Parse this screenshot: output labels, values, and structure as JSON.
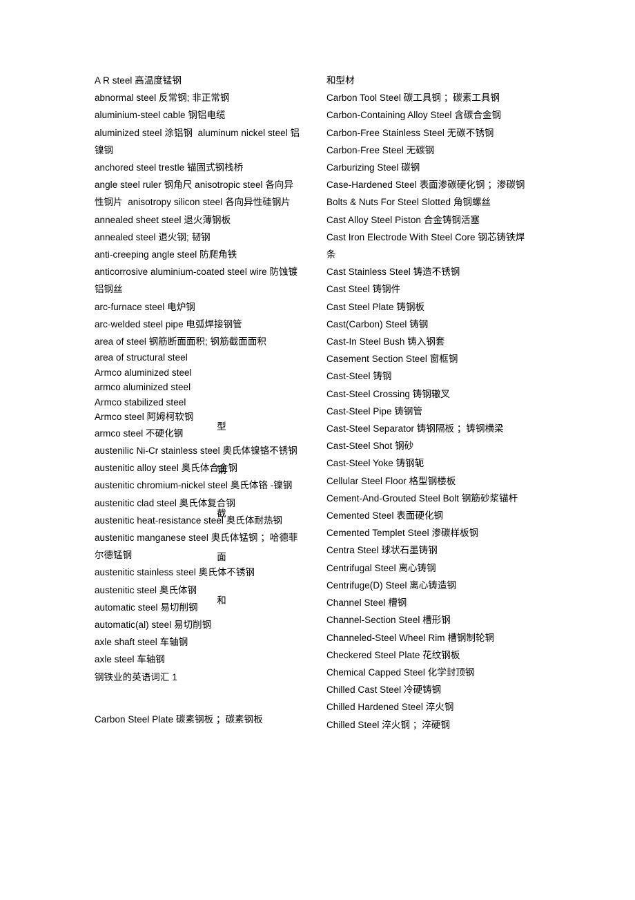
{
  "document": {
    "page_background": "#ffffff",
    "text_color": "#000000",
    "footer_note": "钢铁业的英语词汇 1"
  },
  "left_column": {
    "entries": [
      "A R steel 高温度锰钢",
      "abnormal steel 反常钢; 非正常钢",
      "aluminium-steel cable 钢铝电缆",
      "aluminized steel 涂铝钢  aluminum nickel steel 铝镍钢",
      "anchored steel trestle 锚固式钢栈桥",
      "angle steel ruler 钢角尺 anisotropic steel 各向异性钢片  anisotropy silicon steel 各向异性硅钢片  annealed sheet steel 退火薄钢板",
      "annealed steel 退火钢; 韧钢",
      "anti-creeping angle steel 防爬角铁",
      "anticorrosive aluminium-coated steel wire 防蚀镀铝钢丝",
      "arc-furnace steel 电炉钢",
      "arc-welded steel pipe 电弧焊接钢管",
      "area of steel 钢筋断面面积; 钢筋截面面积",
      "area of structural steel",
      "Armco aluminized steel",
      "armco aluminized steel",
      "Armco stabilized steel",
      "Armco steel 阿姆柯软钢",
      "armco steel 不硬化钢",
      "austenilic Ni-Cr stainless steel 奥氏体镍铬不锈钢",
      "austenitic alloy steel 奥氏体合金钢",
      "austenitic chromium-nickel steel 奥氏体铬 -镍钢",
      "austenitic clad steel 奥氏体复合钢",
      "austenitic heat-resistance steel 奥氏体耐热钢",
      "austenitic manganese steel 奥氏体锰钢 ；哈德菲尔德锰钢",
      "austenitic stainless steel 奥氏体不锈钢",
      "austenitic steel 奥氏体钢",
      "automatic steel 易切削钢",
      "automatic(al) steel 易切削钢",
      "axle shaft steel 车轴钢",
      "axle steel 车轴钢",
      "钢铁业的英语词汇 1",
      "Carbon Steel Plate 碳素钢板 ；碳素钢板"
    ],
    "vertical_text": {
      "characters": [
        "型",
        "钢",
        "截",
        "面",
        "和"
      ],
      "full": "型钢截面和"
    }
  },
  "right_column": {
    "entries": [
      "和型材",
      "Carbon Tool Steel 碳工具钢 ；碳素工具钢",
      "Carbon-Containing Alloy Steel 含碳合金钢",
      "Carbon-Free Stainless Steel 无碳不锈钢",
      "Carbon-Free Steel 无碳钢",
      "Carburizing Steel 碳钢",
      "Case-Hardened Steel 表面渗碳硬化钢 ；渗碳钢",
      "Bolts & Nuts For Steel Slotted 角钢螺丝",
      "Cast Alloy Steel Piston 合金铸钢活塞",
      "Cast Iron Electrode With Steel Core 钢芯铸铁焊条",
      "Cast Stainless Steel 铸造不锈钢",
      "Cast Steel 铸钢件",
      "Cast Steel Plate 铸钢板",
      "Cast(Carbon) Steel 铸钢",
      "Cast-In Steel Bush 铸入钢套",
      "Casement Section Steel 窗框钢",
      "Cast-Steel 铸钢",
      "Cast-Steel Crossing 铸钢辙叉",
      "Cast-Steel Pipe 铸钢管",
      "Cast-Steel Separator 铸钢隔板 ；铸钢横梁",
      "Cast-Steel Shot 钢砂",
      "Cast-Steel Yoke 铸钢轭",
      "Cellular Steel Floor 格型钢楼板",
      "Cement-And-Grouted Steel Bolt 钢筋砂浆锚杆",
      "Cemented Steel 表面硬化钢",
      "Cemented Templet Steel 渗碳样板钢",
      "Centra Steel 球状石墨铸钢",
      "Centrifugal Steel 离心铸钢",
      "Centrifuge(D) Steel 离心铸造钢",
      "Channel Steel 槽钢",
      "Channel-Section Steel 槽形钢",
      "Channeled-Steel Wheel Rim 槽钢制轮辋",
      "Checkered Steel Plate 花纹钢板",
      "Chemical Capped Steel 化学封顶钢",
      "Chilled Cast Steel 冷硬铸钢",
      "Chilled Hardened Steel 淬火钢",
      "Chilled Steel 淬火钢 ；淬硬钢"
    ]
  }
}
